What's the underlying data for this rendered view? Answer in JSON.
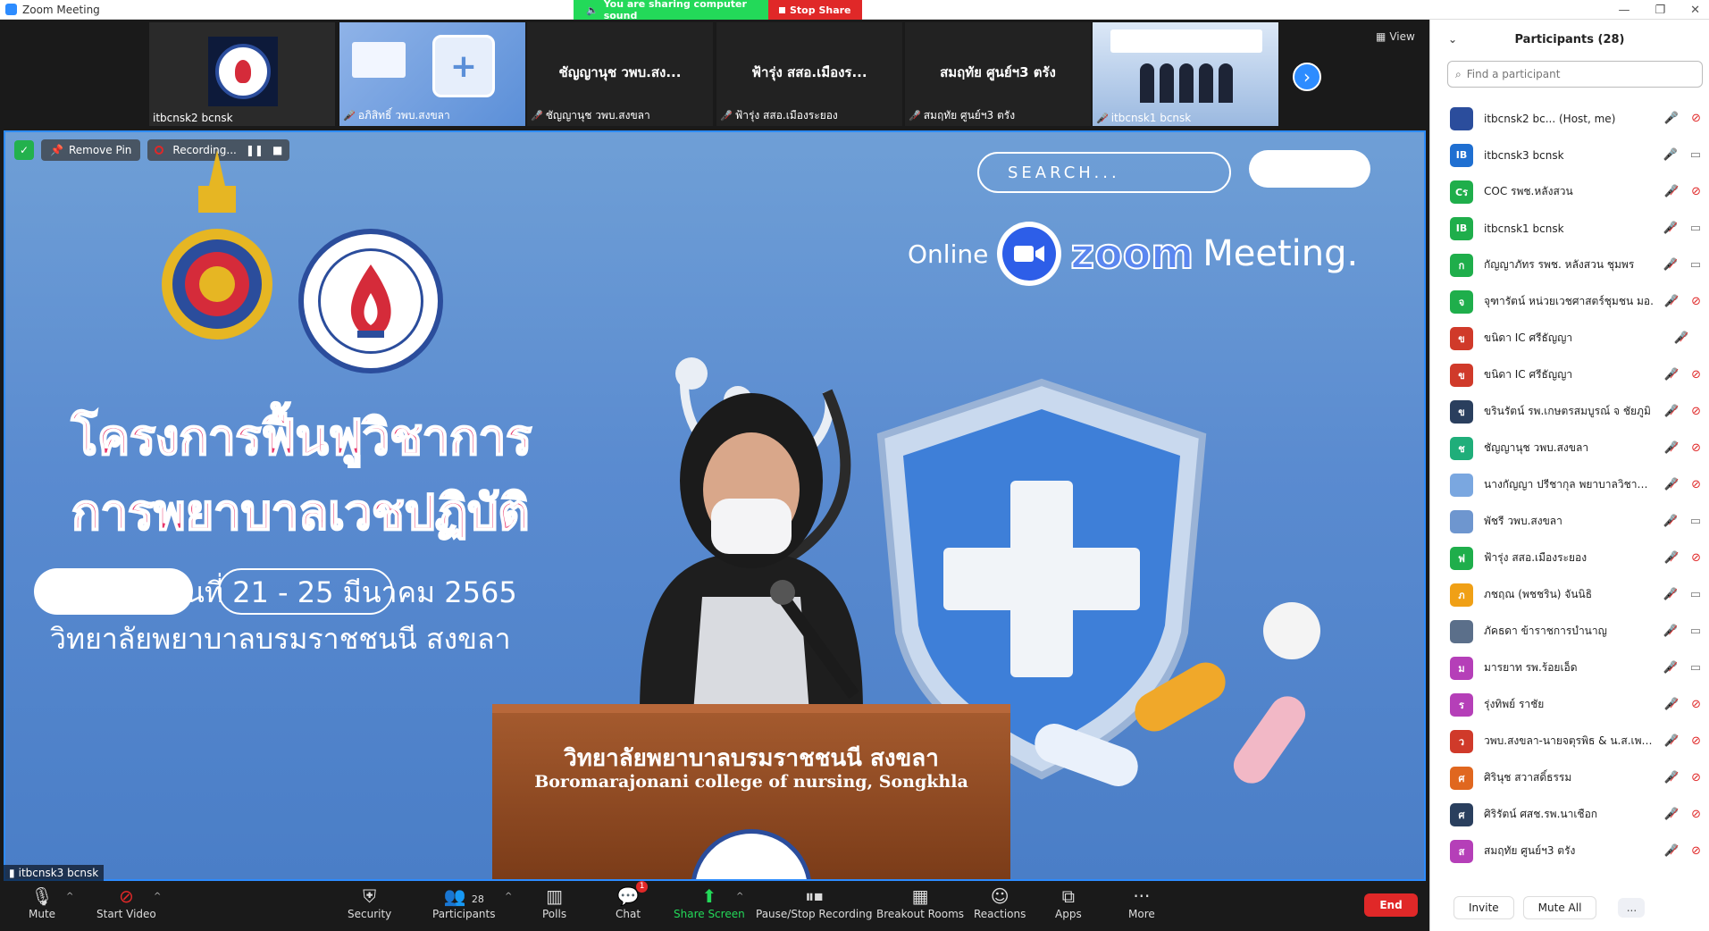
{
  "window": {
    "title": "Zoom Meeting"
  },
  "share_banner": {
    "status": "You are sharing computer sound",
    "stop": "Stop Share"
  },
  "thumbnails": [
    {
      "name": "itbcnsk2 bcnsk",
      "big": ""
    },
    {
      "name": "อภิสิทธิ์ วพบ.สงขลา",
      "big": ""
    },
    {
      "name": "ชัญญานุช วพบ.สงขลา",
      "big": "ชัญญานุช วพบ.สง..."
    },
    {
      "name": "ฟ้ารุ่ง สสอ.เมืองระยอง",
      "big": "ฟ้ารุ่ง สสอ.เมืองร..."
    },
    {
      "name": "สมฤทัย ศูนย์ฯ3 ตรัง",
      "big": "สมฤทัย ศูนย์ฯ3 ตรัง"
    },
    {
      "name": "itbcnsk1 bcnsk",
      "big": ""
    }
  ],
  "view_label": "View",
  "stage": {
    "remove_pin": "Remove Pin",
    "recording": "Recording...",
    "search": "SEARCH...",
    "online": "Online",
    "zoom": "zoom",
    "meeting": "Meeting.",
    "title_line1": "โครงการฟื้นฟูวิชาการ",
    "title_line2": "การพยาบาลเวชปฏิบัติ",
    "date_line1": "ระหว่างวันที่ 21 - 25 มีนาคม 2565",
    "date_line2": "วิทยาลัยพยาบาลบรมราชชนนี สงขลา",
    "podium_th": "วิทยาลัยพยาบาลบรมราชชนนี สงขลา",
    "podium_en": "Boromarajonani college of nursing, Songkhla",
    "speaker": "itbcnsk3 bcnsk"
  },
  "toolbar": {
    "mute": "Mute",
    "start_video": "Start Video",
    "security": "Security",
    "participants": "Participants",
    "participants_count": "28",
    "polls": "Polls",
    "chat": "Chat",
    "chat_badge": "1",
    "share_screen": "Share Screen",
    "pause_stop": "Pause/Stop Recording",
    "breakout": "Breakout Rooms",
    "reactions": "Reactions",
    "apps": "Apps",
    "more": "More",
    "end": "End"
  },
  "panel": {
    "title": "Participants (28)",
    "search_placeholder": "Find a participant",
    "invite": "Invite",
    "mute_all": "Mute All",
    "more": "...",
    "participants": [
      {
        "initial": "",
        "name": "itbcnsk2 bc...  (Host, me)",
        "color": "#2b4d9c",
        "mic": "on",
        "video": "off"
      },
      {
        "initial": "IB",
        "name": "itbcnsk3 bcnsk",
        "color": "#1f6fd1",
        "mic": "on",
        "video": "on"
      },
      {
        "initial": "Cร",
        "name": "COC รพช.หลังสวน",
        "color": "#1fae4b",
        "mic": "off",
        "video": "off"
      },
      {
        "initial": "IB",
        "name": "itbcnsk1 bcnsk",
        "color": "#1fae4b",
        "mic": "off",
        "video": "on"
      },
      {
        "initial": "ก",
        "name": "กัญญาภัทร รพช. หลังสวน ชุมพร",
        "color": "#1fae4b",
        "mic": "off",
        "video": "on"
      },
      {
        "initial": "จ",
        "name": "จุฑารัตน์ หน่วยเวชศาสตร์ชุมชน มอ.",
        "color": "#1fae4b",
        "mic": "off",
        "video": "off"
      },
      {
        "initial": "ข",
        "name": "ขนิดา IC ศรีธัญญา",
        "color": "#d03a2a",
        "mic": "off",
        "video": ""
      },
      {
        "initial": "ข",
        "name": "ขนิดา IC ศรีธัญญา",
        "color": "#d03a2a",
        "mic": "off",
        "video": "off"
      },
      {
        "initial": "ข",
        "name": "ขรินรัตน์ รพ.เกษตรสมบูรณ์ จ ชัยภูมิ",
        "color": "#2a3f5e",
        "mic": "off",
        "video": "off"
      },
      {
        "initial": "ช",
        "name": "ชัญญานุช วพบ.สงขลา",
        "color": "#1fae7a",
        "mic": "off",
        "video": "off"
      },
      {
        "initial": "",
        "name": "นางกัญญา ปรีชากุล พยาบาลวิชาชี...",
        "color": "#7aa7e0",
        "mic": "off",
        "video": "off"
      },
      {
        "initial": "",
        "name": "พัชรี วพบ.สงขลา",
        "color": "#6e96cf",
        "mic": "off",
        "video": "on"
      },
      {
        "initial": "ฟ",
        "name": "ฟ้ารุ่ง สสอ.เมืองระยอง",
        "color": "#1fae4b",
        "mic": "off",
        "video": "off"
      },
      {
        "initial": "ภ",
        "name": "ภชฤณ (พชชริน) จันนิธิ",
        "color": "#f0a016",
        "mic": "off",
        "video": "on"
      },
      {
        "initial": "",
        "name": "ภัคธดา ข้าราชการบำนาญ",
        "color": "#5b6f8a",
        "mic": "off",
        "video": "on"
      },
      {
        "initial": "ม",
        "name": "มารยาท รพ.ร้อยเอ็ด",
        "color": "#b53fb8",
        "mic": "off",
        "video": "on"
      },
      {
        "initial": "ร",
        "name": "รุ่งทิพย์ ราชัย",
        "color": "#b53fb8",
        "mic": "off",
        "video": "off"
      },
      {
        "initial": "ว",
        "name": "วพบ.สงขลา-นายจตุรพิธ & น.ส.เพม...",
        "color": "#d03a2a",
        "mic": "off",
        "video": "off"
      },
      {
        "initial": "ศ",
        "name": "ศิรินุช สวาสดิ์ธรรม",
        "color": "#e0671f",
        "mic": "off",
        "video": "off"
      },
      {
        "initial": "ศ",
        "name": "ศิริรัตน์ ศสช.รพ.นาเชือก",
        "color": "#2a3f5e",
        "mic": "off",
        "video": "off"
      },
      {
        "initial": "ส",
        "name": "สมฤทัย ศูนย์ฯ3 ตรัง",
        "color": "#b53fb8",
        "mic": "off",
        "video": "off"
      }
    ]
  }
}
